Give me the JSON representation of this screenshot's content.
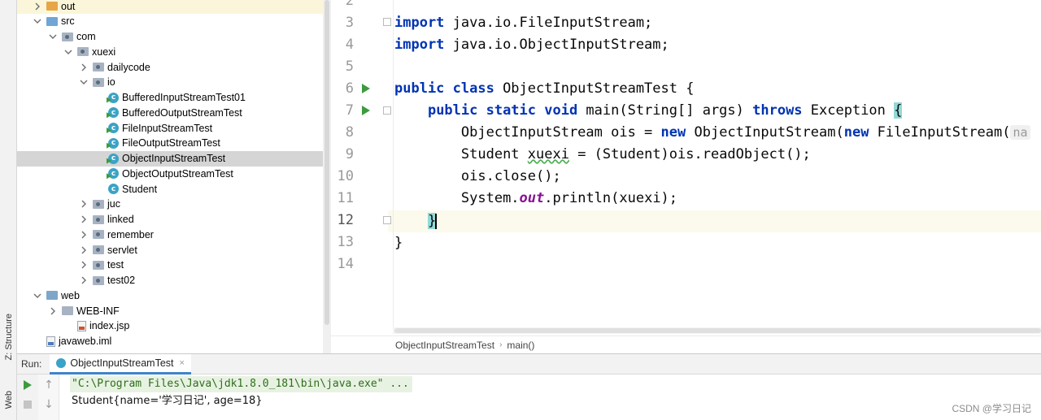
{
  "left_strip": {
    "structure_tab": "Z: Structure",
    "web_tab": "Web"
  },
  "project_tree": {
    "items": [
      {
        "label": "out",
        "type": "folder-orange",
        "indent": 1,
        "arrow": "right"
      },
      {
        "label": "src",
        "type": "folder-blue",
        "indent": 1,
        "arrow": "down"
      },
      {
        "label": "com",
        "type": "package",
        "indent": 2,
        "arrow": "down"
      },
      {
        "label": "xuexi",
        "type": "package",
        "indent": 3,
        "arrow": "down"
      },
      {
        "label": "dailycode",
        "type": "package",
        "indent": 4,
        "arrow": "right"
      },
      {
        "label": "io",
        "type": "package",
        "indent": 4,
        "arrow": "down"
      },
      {
        "label": "BufferedInputStreamTest01",
        "type": "class-run",
        "indent": 5
      },
      {
        "label": "BufferedOutputStreamTest",
        "type": "class-run",
        "indent": 5
      },
      {
        "label": "FileInputStreamTest",
        "type": "class-run",
        "indent": 5
      },
      {
        "label": "FileOutputStreamTest",
        "type": "class-run",
        "indent": 5
      },
      {
        "label": "ObjectInputStreamTest",
        "type": "class-run",
        "indent": 5,
        "selected": true
      },
      {
        "label": "ObjectOutputStreamTest",
        "type": "class-run",
        "indent": 5
      },
      {
        "label": "Student",
        "type": "class",
        "indent": 5
      },
      {
        "label": "juc",
        "type": "package",
        "indent": 4,
        "arrow": "right"
      },
      {
        "label": "linked",
        "type": "package",
        "indent": 4,
        "arrow": "right"
      },
      {
        "label": "remember",
        "type": "package",
        "indent": 4,
        "arrow": "right"
      },
      {
        "label": "servlet",
        "type": "package",
        "indent": 4,
        "arrow": "right"
      },
      {
        "label": "test",
        "type": "package",
        "indent": 4,
        "arrow": "right"
      },
      {
        "label": "test02",
        "type": "package",
        "indent": 4,
        "arrow": "right"
      },
      {
        "label": "web",
        "type": "folder-web",
        "indent": 1,
        "arrow": "down"
      },
      {
        "label": "WEB-INF",
        "type": "folder",
        "indent": 2,
        "arrow": "right"
      },
      {
        "label": "index.jsp",
        "type": "jsp",
        "indent": 3
      },
      {
        "label": "javaweb.iml",
        "type": "iml",
        "indent": 1
      }
    ]
  },
  "editor": {
    "line_numbers": [
      "2",
      "3",
      "4",
      "5",
      "6",
      "7",
      "8",
      "9",
      "10",
      "11",
      "12",
      "13",
      "14"
    ],
    "current_line": "12",
    "code": {
      "l3_kw": "import",
      "l3_rest": " java.io.FileInputStream;",
      "l4_kw": "import",
      "l4_rest": " java.io.ObjectInputStream;",
      "l6_kw": "public class",
      "l6_rest": " ObjectInputStreamTest {",
      "l7_kw1": "public static void",
      "l7_mid": " main(String[] args) ",
      "l7_kw2": "throws",
      "l7_rest": " Exception ",
      "l7_brace": "{",
      "l8_a": "ObjectInputStream ois = ",
      "l8_new1": "new",
      "l8_b": " ObjectInputStream(",
      "l8_new2": "new",
      "l8_c": " FileInputStream(",
      "l8_hint": "na",
      "l9_a": "Student ",
      "l9_var": "xuexi",
      "l9_b": " = (Student)ois.readObject();",
      "l10": "ois.close();",
      "l11_a": "System.",
      "l11_field": "out",
      "l11_b": ".println(xuexi);",
      "l12_brace": "}",
      "l13": "}"
    }
  },
  "breadcrumb": {
    "items": [
      "ObjectInputStreamTest",
      "main()"
    ]
  },
  "run_panel": {
    "label": "Run:",
    "tab_title": "ObjectInputStreamTest",
    "tab_close": "×",
    "command_line": "\"C:\\Program Files\\Java\\jdk1.8.0_181\\bin\\java.exe\" ...",
    "output_line": "Student{name='学习日记', age=18}"
  },
  "watermark": "CSDN @学习日记",
  "colors": {
    "keyword": "#0033b3",
    "static_field": "#871094",
    "run_green": "#3d9b3d",
    "selection": "#d5d5d5",
    "current_line": "#fcfaed",
    "brace_match": "#93d9d9"
  }
}
